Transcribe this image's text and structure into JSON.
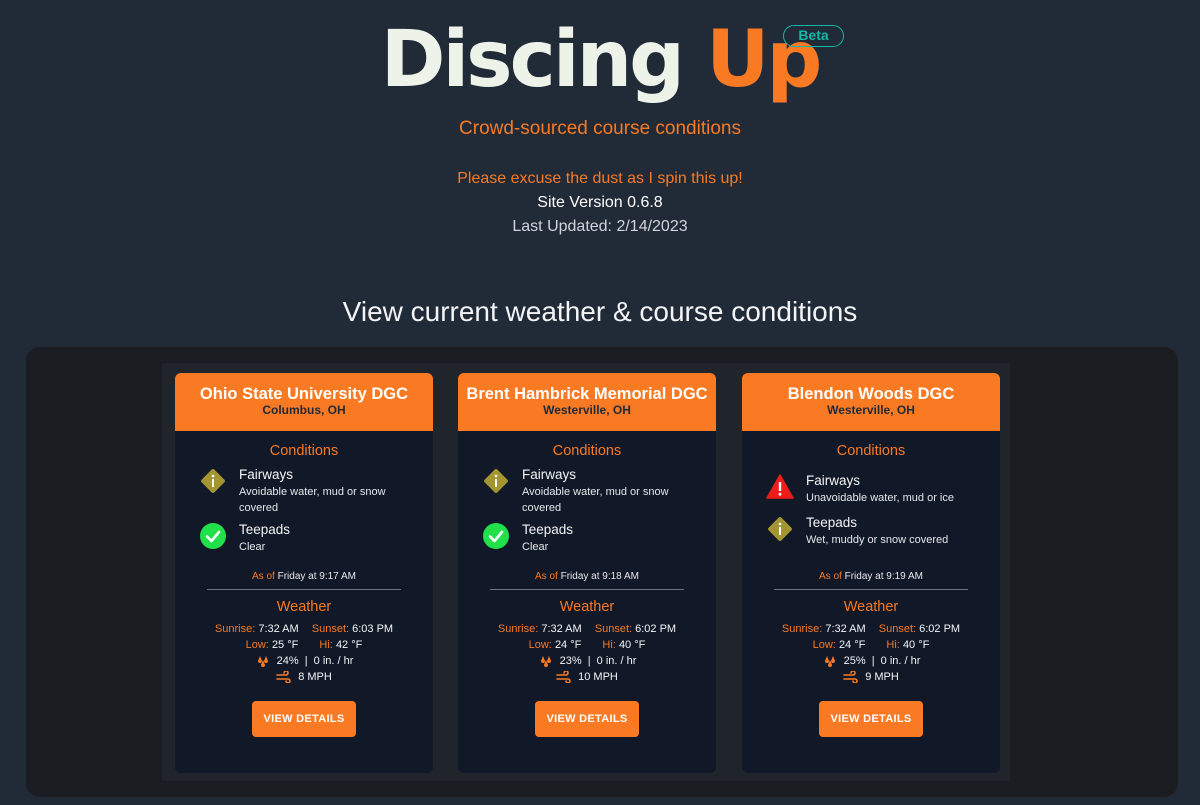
{
  "header": {
    "logo_word1": "Discing",
    "logo_word2": "Up",
    "badge": "Beta",
    "tagline": "Crowd-sourced course conditions",
    "notice": "Please excuse the dust as I spin this up!",
    "version": "Site Version 0.6.8",
    "updated": "Last Updated: 2/14/2023"
  },
  "main": {
    "section_title": "View current weather & course conditions"
  },
  "labels": {
    "conditions": "Conditions",
    "as_of": "As of",
    "weather": "Weather",
    "sunrise": "Sunrise:",
    "sunset": "Sunset:",
    "low": "Low:",
    "hi": "Hi:",
    "details_button": "VIEW DETAILS"
  },
  "colors": {
    "accent": "#f97a23",
    "background": "#212a37",
    "card": "#111827",
    "warning": "#a39532",
    "danger": "#ef1c1c",
    "ok": "#22e04a",
    "beta": "#14b8a6"
  },
  "courses": [
    {
      "name": "Ohio State University DGC",
      "location": "Columbus, OH",
      "conditions": [
        {
          "name": "Fairways",
          "desc": "Avoidable water, mud or snow covered",
          "icon": "warning-diamond-icon"
        },
        {
          "name": "Teepads",
          "desc": "Clear",
          "icon": "check-circle-icon"
        }
      ],
      "as_of": "Friday at 9:17 AM",
      "sunrise": "7:32 AM",
      "sunset": "6:03 PM",
      "low": "25 °F",
      "hi": "42 °F",
      "precip": "24%  |  0 in. / hr",
      "wind": "8 MPH"
    },
    {
      "name": "Brent Hambrick Memorial DGC",
      "location": "Westerville, OH",
      "conditions": [
        {
          "name": "Fairways",
          "desc": "Avoidable water, mud or snow covered",
          "icon": "warning-diamond-icon"
        },
        {
          "name": "Teepads",
          "desc": "Clear",
          "icon": "check-circle-icon"
        }
      ],
      "as_of": "Friday at 9:18 AM",
      "sunrise": "7:32 AM",
      "sunset": "6:02 PM",
      "low": "24 °F",
      "hi": "40 °F",
      "precip": "23%  |  0 in. / hr",
      "wind": "10 MPH"
    },
    {
      "name": "Blendon Woods DGC",
      "location": "Westerville, OH",
      "conditions": [
        {
          "name": "Fairways",
          "desc": "Unavoidable water, mud or ice",
          "icon": "alert-triangle-icon"
        },
        {
          "name": "Teepads",
          "desc": "Wet, muddy or snow covered",
          "icon": "warning-diamond-icon"
        }
      ],
      "as_of": "Friday at 9:19 AM",
      "sunrise": "7:32 AM",
      "sunset": "6:02 PM",
      "low": "24 °F",
      "hi": "40 °F",
      "precip": "25%  |  0 in. / hr",
      "wind": "9 MPH"
    }
  ]
}
